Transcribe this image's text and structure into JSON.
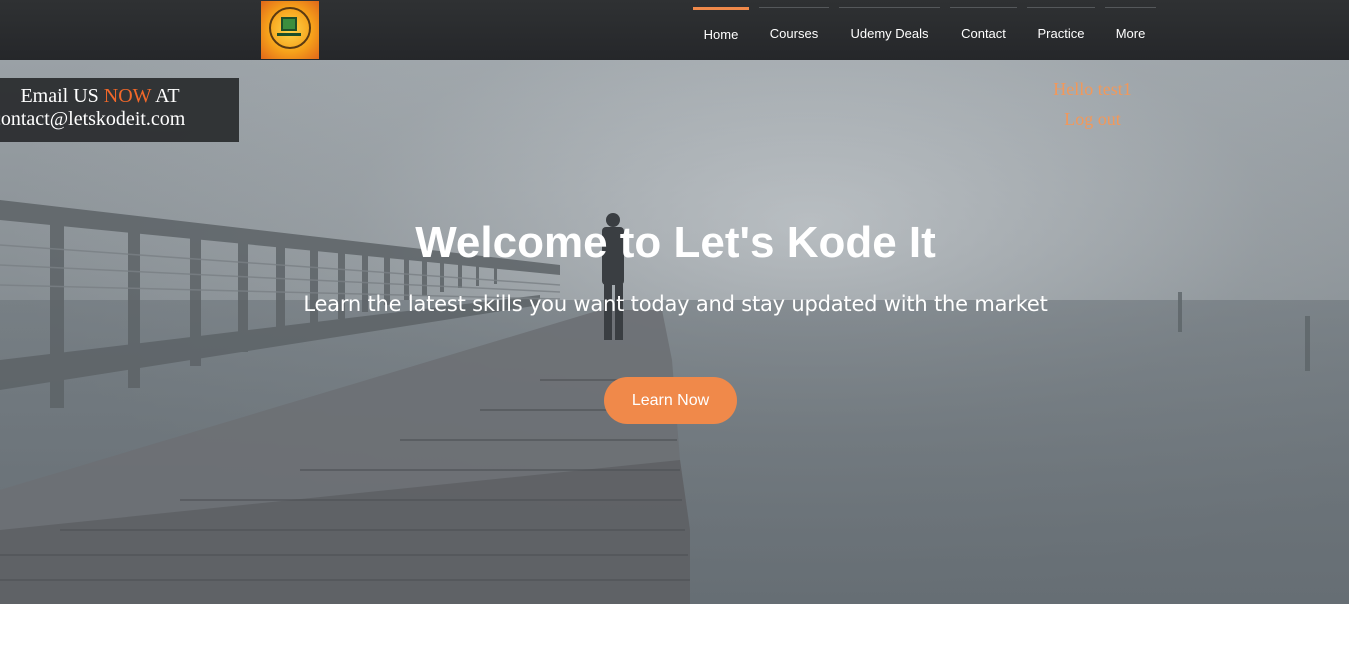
{
  "header": {
    "logo_alt": "Let's Kode It",
    "nav": [
      {
        "label": "Home",
        "active": true
      },
      {
        "label": "Courses",
        "active": false
      },
      {
        "label": "Udemy Deals",
        "active": false
      },
      {
        "label": "Contact",
        "active": false
      },
      {
        "label": "Practice",
        "active": false
      },
      {
        "label": "More",
        "active": false
      }
    ]
  },
  "hero": {
    "email_prefix": "Email US",
    "email_highlight": "NOW",
    "email_suffix": "AT",
    "email_address": "contact@letskodeit.com",
    "greeting": "Hello test1",
    "logout_label": "Log out",
    "title": "Welcome to Let's Kode It",
    "subtitle": "Learn the latest skills you want today and stay updated with the market",
    "cta_label": "Learn Now"
  },
  "colors": {
    "accent": "#f0894a",
    "header_bg": "#2a2c2e",
    "email_highlight": "#f2682a"
  }
}
